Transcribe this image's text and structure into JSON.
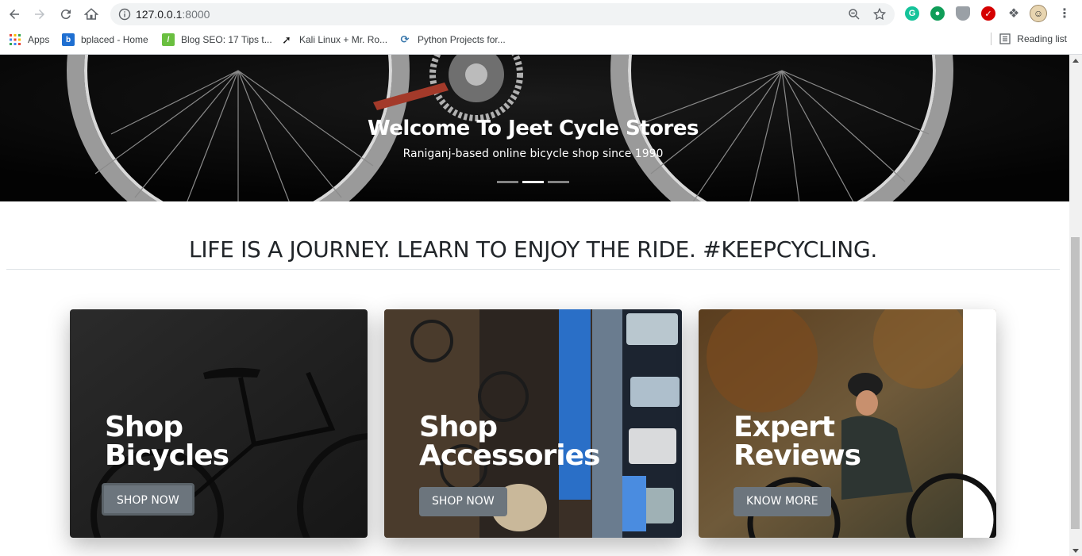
{
  "browser": {
    "url_host": "127.0.0.1",
    "url_port": ":8000",
    "bookmarks": [
      {
        "label": "Apps",
        "icon": "apps-grid-icon"
      },
      {
        "label": "bplaced - Home",
        "icon": "bplaced-favicon"
      },
      {
        "label": "Blog SEO: 17 Tips t...",
        "icon": "blog-seo-favicon"
      },
      {
        "label": "Kali Linux + Mr. Ro...",
        "icon": "kali-favicon"
      },
      {
        "label": "Python Projects for...",
        "icon": "python-projects-favicon"
      }
    ],
    "reading_list": "Reading list"
  },
  "hero": {
    "title": "Welcome To Jeet Cycle Stores",
    "subtitle": "Raniganj-based online bicycle shop since 1990",
    "slides": 3,
    "active_slide": 1
  },
  "tagline": "LIFE IS A JOURNEY. LEARN TO ENJOY THE RIDE. #KEEPCYCLING.",
  "cards": [
    {
      "line1": "Shop",
      "line2": "Bicycles",
      "button": "SHOP NOW"
    },
    {
      "line1": "Shop",
      "line2": "Accessories",
      "button": "SHOP NOW"
    },
    {
      "line1": "Expert",
      "line2": "Reviews",
      "button": "KNOW MORE"
    }
  ],
  "colors": {
    "button_bg": "#6c757d",
    "heading_text": "#212529",
    "hero_bg": "#050505"
  }
}
